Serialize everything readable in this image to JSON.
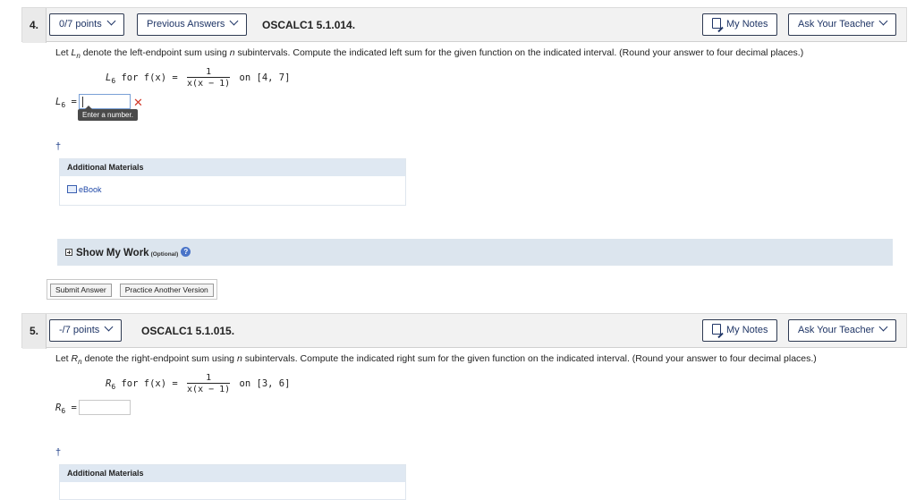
{
  "questions": [
    {
      "number": "4.",
      "points": "0/7 points",
      "previous_answers": "Previous Answers",
      "id": "OSCALC1 5.1.014.",
      "my_notes": "My Notes",
      "ask_teacher": "Ask Your Teacher",
      "prompt_pre": "Let ",
      "prompt_var": "L",
      "prompt_sub": "n",
      "prompt_post": " denote the left-endpoint sum using ",
      "prompt_n": "n",
      "prompt_tail": " subintervals. Compute the indicated left sum for the given function on the indicated interval. (Round your answer to four decimal places.)",
      "formula_lhs_var": "L",
      "formula_lhs_sub": "6",
      "formula_for": " for ",
      "formula_fx": "f(x) =",
      "formula_num": "1",
      "formula_den": "x(x − 1)",
      "formula_interval": "on [4, 7]",
      "answer_label_var": "L",
      "answer_label_sub": "6",
      "answer_eq": " =",
      "answer_value": "",
      "error_mark": "✕",
      "tooltip": "Enter a number.",
      "dagger": "†",
      "additional_materials": "Additional Materials",
      "ebook": "eBook",
      "show_my_work": "Show My Work",
      "optional": "(Optional)",
      "help": "?",
      "submit": "Submit Answer",
      "practice": "Practice Another Version"
    },
    {
      "number": "5.",
      "points": "-/7 points",
      "id": "OSCALC1 5.1.015.",
      "my_notes": "My Notes",
      "ask_teacher": "Ask Your Teacher",
      "prompt_pre": "Let ",
      "prompt_var": "R",
      "prompt_sub": "n",
      "prompt_post": " denote the right-endpoint sum using ",
      "prompt_n": "n",
      "prompt_tail": " subintervals. Compute the indicated right sum for the given function on the indicated interval. (Round your answer to four decimal places.)",
      "formula_lhs_var": "R",
      "formula_lhs_sub": "6",
      "formula_for": " for ",
      "formula_fx": "f(x) =",
      "formula_num": "1",
      "formula_den": "x(x − 1)",
      "formula_interval": "on [3, 6]",
      "answer_label_var": "R",
      "answer_label_sub": "6",
      "answer_eq": " =",
      "answer_value": "",
      "dagger": "†",
      "additional_materials": "Additional Materials"
    }
  ]
}
